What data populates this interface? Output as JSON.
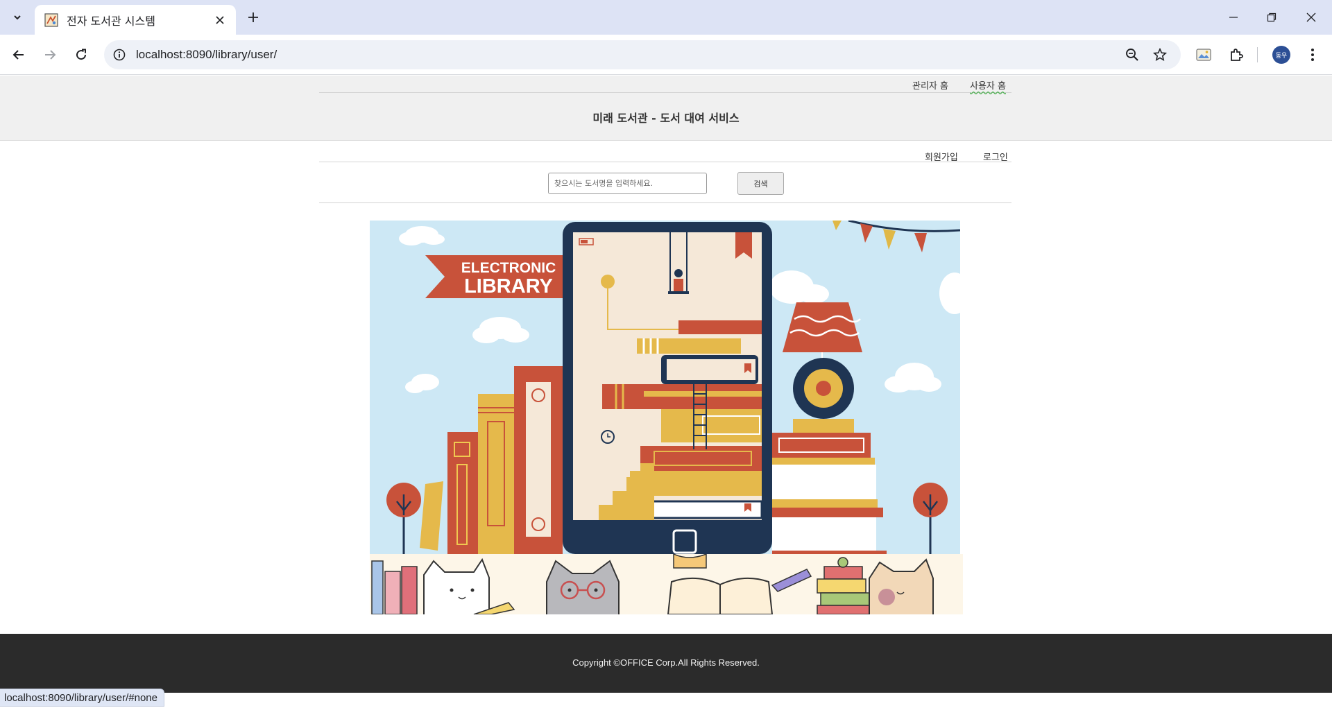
{
  "browser": {
    "tab_title": "전자 도서관 시스템",
    "url": "localhost:8090/library/user/",
    "profile_initials": "동우",
    "status_url": "localhost:8090/library/user/#none"
  },
  "header": {
    "links": [
      "관리자 홈",
      "사용자 홈"
    ],
    "title": "미래 도서관 - 도서 대여 서비스"
  },
  "user_menu": {
    "links": [
      "회원가입",
      "로그인"
    ]
  },
  "search": {
    "placeholder": "찾으시는 도서명을 입력하세요.",
    "button_label": "검색"
  },
  "banner": {
    "lines": [
      "ELECTRONIC",
      "LIBRARY"
    ]
  },
  "footer": {
    "copyright": "Copyright ©OFFICE Corp.All Rights Reserved."
  }
}
